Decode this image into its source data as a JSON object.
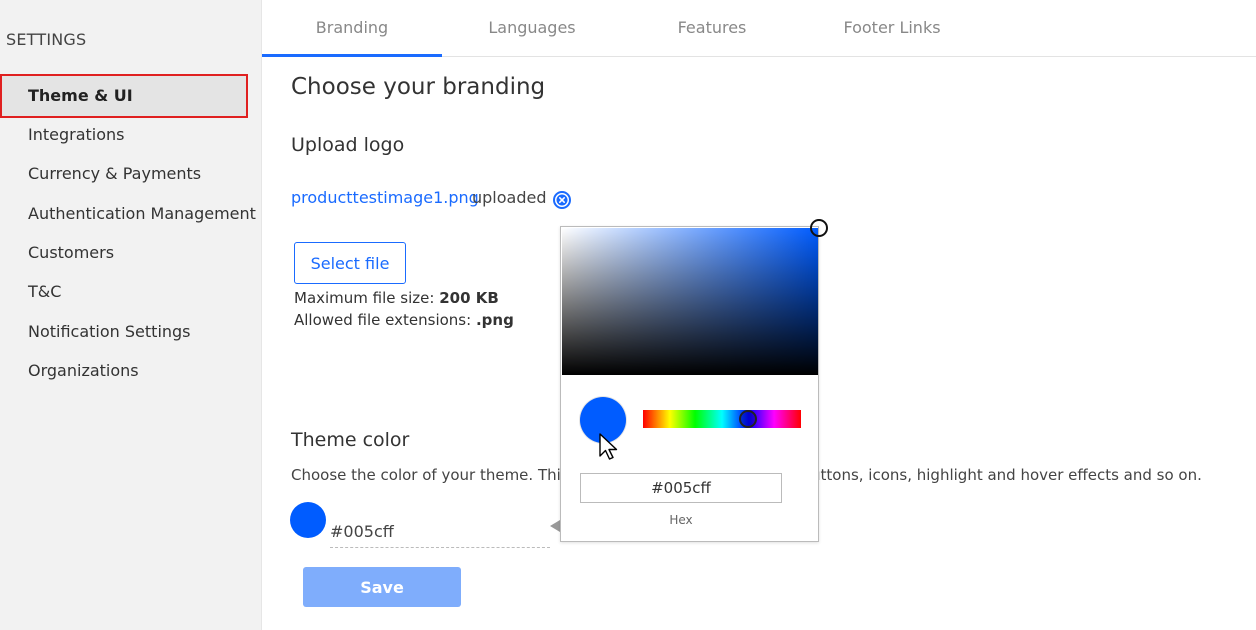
{
  "sidebar": {
    "title": "SETTINGS",
    "items": [
      {
        "label": "Theme & UI",
        "active": true
      },
      {
        "label": "Integrations"
      },
      {
        "label": "Currency & Payments"
      },
      {
        "label": "Authentication Management"
      },
      {
        "label": "Customers"
      },
      {
        "label": "T&C"
      },
      {
        "label": "Notification Settings"
      },
      {
        "label": "Organizations"
      }
    ]
  },
  "tabs": [
    {
      "label": "Branding",
      "active": true
    },
    {
      "label": "Languages"
    },
    {
      "label": "Features"
    },
    {
      "label": "Footer Links"
    }
  ],
  "main": {
    "title": "Choose your branding",
    "upload": {
      "heading": "Upload logo",
      "file_name": "producttestimage1.png",
      "file_status": "uploaded",
      "select_label": "Select file",
      "max_size_label": "Maximum file size:",
      "max_size_value": "200 KB",
      "extensions_label": "Allowed file extensions:",
      "extensions_value": ".png"
    },
    "theme": {
      "heading": "Theme color",
      "description_visible_left": "Choose the color of your theme. This",
      "description_visible_right": "uttons, icons, highlight and hover effects and so on.",
      "color_value": "#005cff",
      "save_label": "Save"
    }
  },
  "color_picker": {
    "hex": "#005cff",
    "hex_label": "Hex",
    "hue_level": 0.6
  },
  "colors": {
    "accent": "#1a6bff",
    "theme": "#005cff",
    "save_disabled": "#7fadfc",
    "highlight_border": "#e02020"
  }
}
